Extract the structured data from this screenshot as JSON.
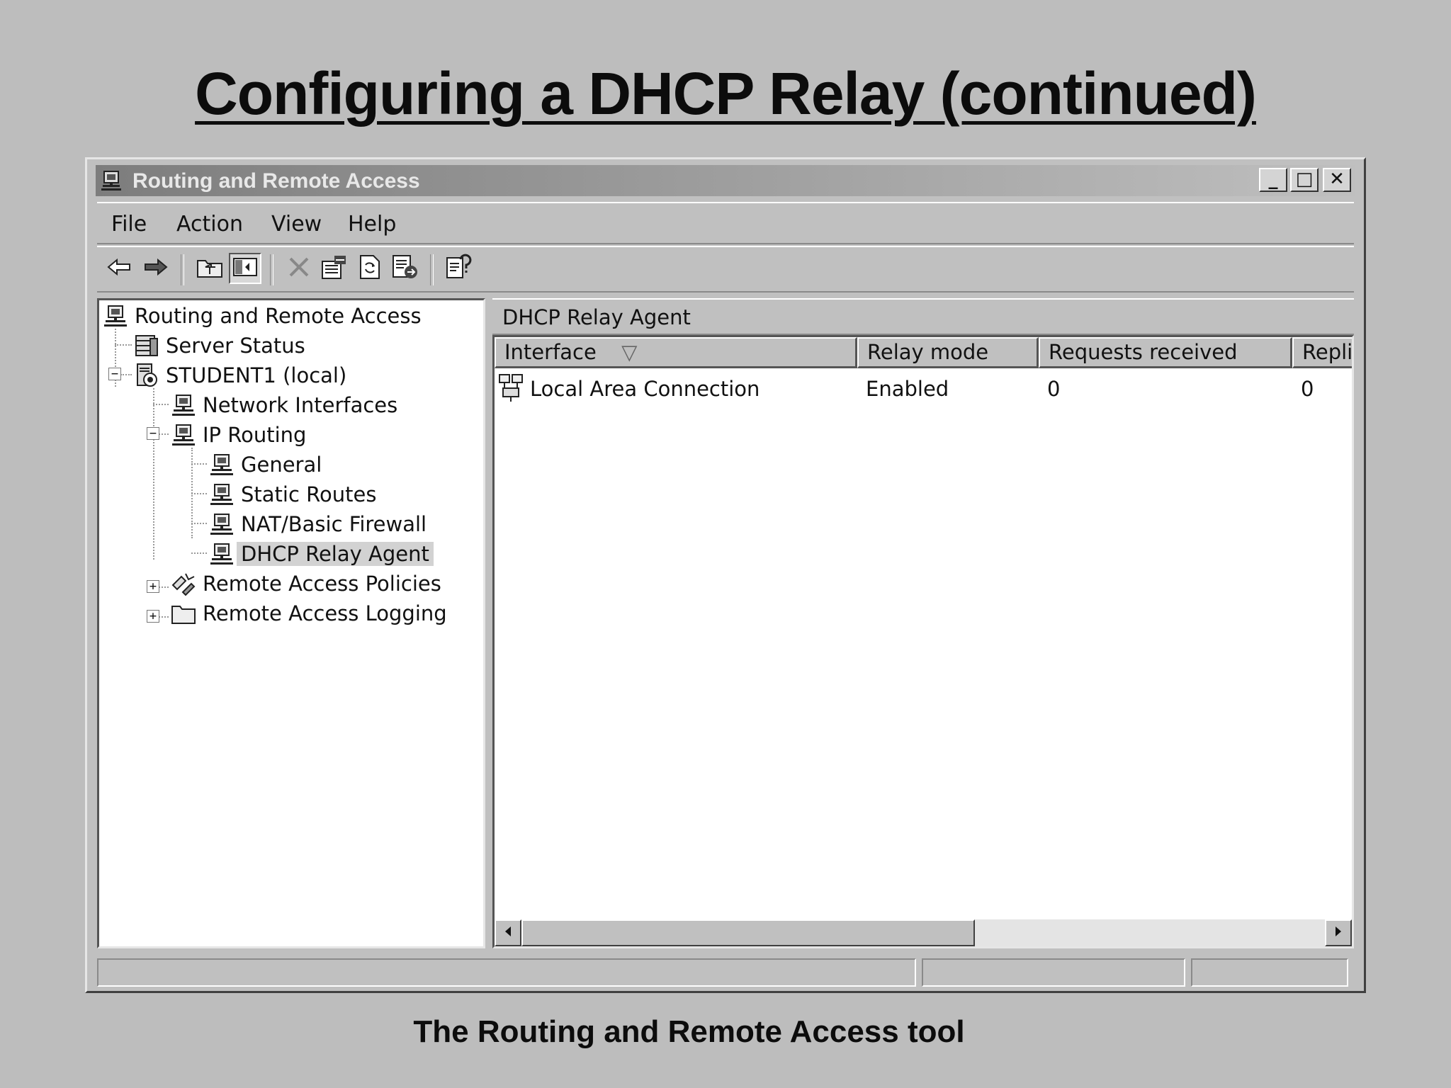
{
  "slide": {
    "title": "Configuring a DHCP Relay (continued)",
    "caption": "The Routing and Remote Access tool"
  },
  "window": {
    "title": "Routing and Remote Access",
    "controls": {
      "minimize": "_",
      "maximize": "□",
      "close": "✕"
    }
  },
  "menu": [
    "File",
    "Action",
    "View",
    "Help"
  ],
  "toolbar": {
    "buttons": [
      "back-icon",
      "forward-icon",
      "up-one-level-icon",
      "show-hide-console-tree-icon",
      "delete-icon",
      "properties-icon",
      "refresh-icon",
      "export-list-icon",
      "help-icon"
    ]
  },
  "tree": {
    "root": "Routing and Remote Access",
    "server_status": "Server Status",
    "server": "STUDENT1 (local)",
    "network_interfaces": "Network Interfaces",
    "ip_routing": "IP Routing",
    "general": "General",
    "static_routes": "Static Routes",
    "nat": "NAT/Basic Firewall",
    "dhcp_relay": "DHCP Relay Agent",
    "policies": "Remote Access Policies",
    "logging": "Remote Access Logging"
  },
  "content": {
    "header": "DHCP Relay Agent",
    "columns": [
      "Interface",
      "Relay mode",
      "Requests received",
      "Replie"
    ],
    "sort_indicator": "▽",
    "rows": [
      {
        "interface": "Local Area Connection",
        "relay_mode": "Enabled",
        "requests_received": "0",
        "replies": "0"
      }
    ]
  }
}
